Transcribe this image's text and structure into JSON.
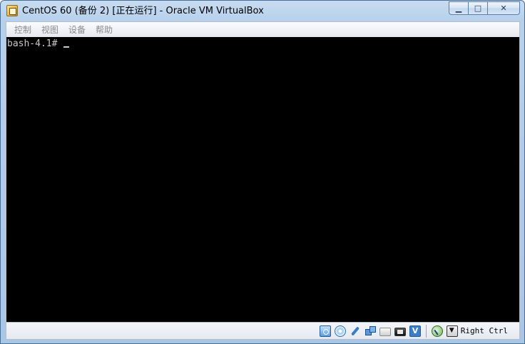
{
  "window": {
    "title": "CentOS 60 (备份 2) [正在运行] - Oracle VM VirtualBox",
    "controls": {
      "minimize_symbol": "▁",
      "maximize_symbol": "□",
      "close_symbol": "✕"
    }
  },
  "menu": {
    "items": [
      "控制",
      "视图",
      "设备",
      "帮助"
    ],
    "text_color": "#8a8a8a"
  },
  "console": {
    "prompt": "bash-4.1# ",
    "background": "#000000",
    "text_color": "#c8c8c8"
  },
  "statusbar": {
    "icons": [
      "hard-disk-icon",
      "optical-drive-icon",
      "usb-icon",
      "network-icon",
      "shared-folder-icon",
      "display-icon",
      "vt-x-icon",
      "mouse-integration-icon",
      "keyboard-capture-icon"
    ],
    "host_key": "Right Ctrl"
  }
}
